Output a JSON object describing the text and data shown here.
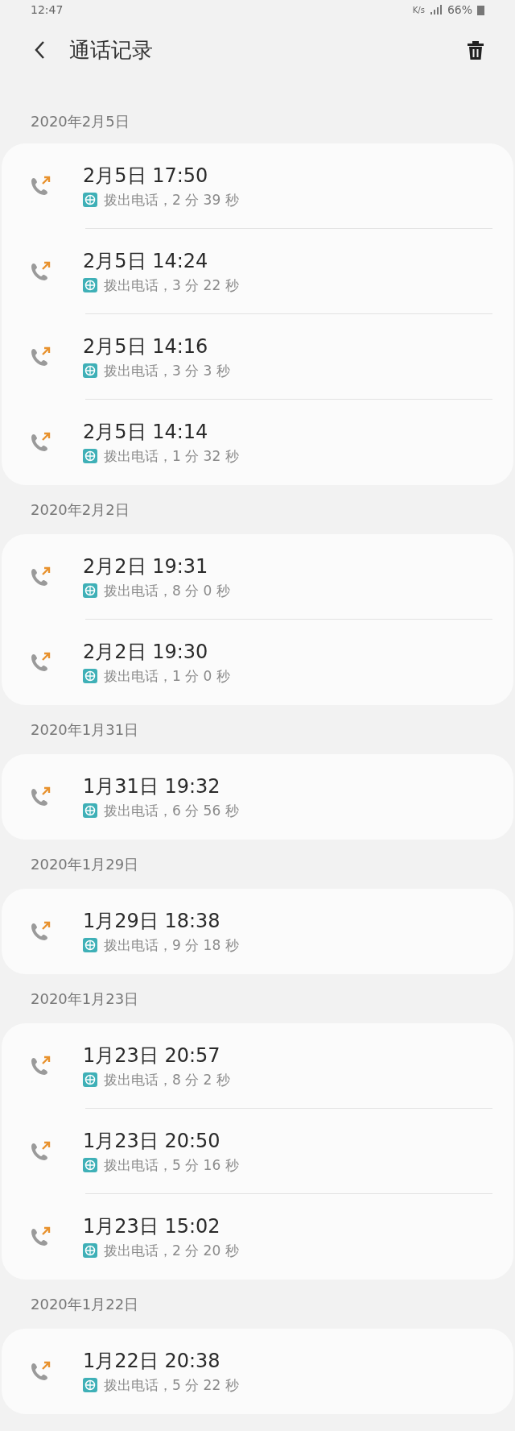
{
  "status_bar": {
    "time": "12:47",
    "speed": "K/s",
    "battery": "66%"
  },
  "toolbar": {
    "title": "通话记录"
  },
  "sections": [
    {
      "date": "2020年2月5日",
      "calls": [
        {
          "kind": "outgoing",
          "time": "2月5日 17:50",
          "detail": "拨出电话，2 分 39 秒"
        },
        {
          "kind": "outgoing",
          "time": "2月5日 14:24",
          "detail": "拨出电话，3 分 22 秒"
        },
        {
          "kind": "outgoing",
          "time": "2月5日 14:16",
          "detail": "拨出电话，3 分 3 秒"
        },
        {
          "kind": "outgoing",
          "time": "2月5日 14:14",
          "detail": "拨出电话，1 分 32 秒"
        }
      ]
    },
    {
      "date": "2020年2月2日",
      "calls": [
        {
          "kind": "outgoing",
          "time": "2月2日 19:31",
          "detail": "拨出电话，8 分 0 秒"
        },
        {
          "kind": "outgoing",
          "time": "2月2日 19:30",
          "detail": "拨出电话，1 分 0 秒"
        }
      ]
    },
    {
      "date": "2020年1月31日",
      "calls": [
        {
          "kind": "outgoing",
          "time": "1月31日 19:32",
          "detail": "拨出电话，6 分 56 秒"
        }
      ]
    },
    {
      "date": "2020年1月29日",
      "calls": [
        {
          "kind": "outgoing",
          "time": "1月29日 18:38",
          "detail": "拨出电话，9 分 18 秒"
        }
      ]
    },
    {
      "date": "2020年1月23日",
      "calls": [
        {
          "kind": "outgoing",
          "time": "1月23日 20:57",
          "detail": "拨出电话，8 分 2 秒"
        },
        {
          "kind": "outgoing",
          "time": "1月23日 20:50",
          "detail": "拨出电话，5 分 16 秒"
        },
        {
          "kind": "outgoing",
          "time": "1月23日 15:02",
          "detail": "拨出电话，2 分 20 秒"
        }
      ]
    },
    {
      "date": "2020年1月22日",
      "calls": [
        {
          "kind": "outgoing",
          "time": "1月22日 20:38",
          "detail": "拨出电话，5 分 22 秒"
        }
      ]
    }
  ]
}
